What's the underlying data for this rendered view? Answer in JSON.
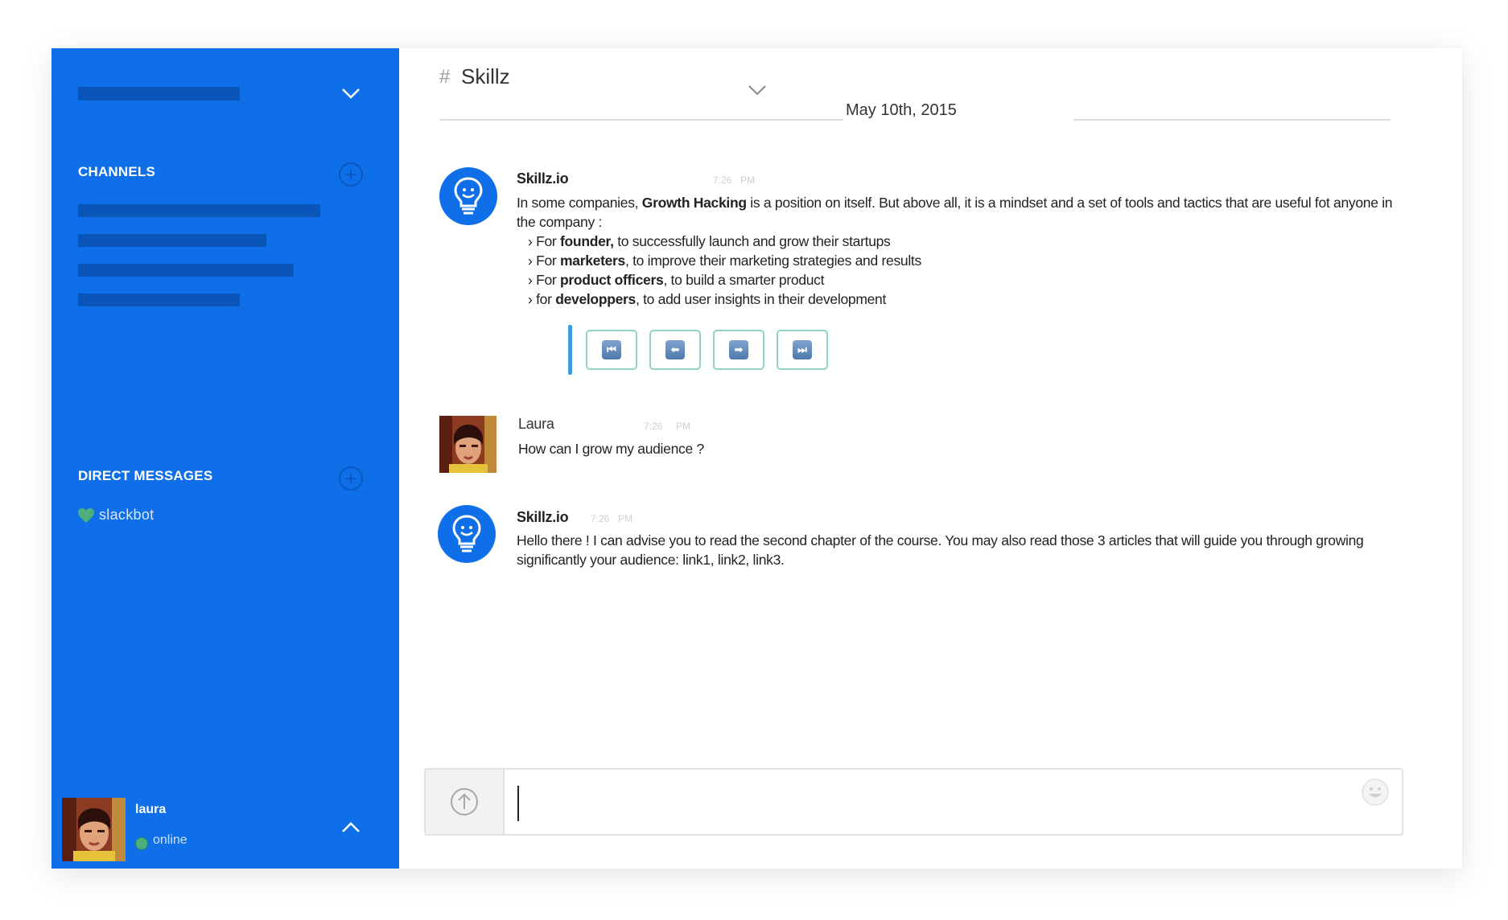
{
  "sidebar": {
    "channels_title": "CHANNELS",
    "dm_title": "DIRECT MESSAGES",
    "direct_messages": [
      {
        "name": "slackbot"
      }
    ],
    "current_user": {
      "name": "laura",
      "status": "online"
    }
  },
  "channel": {
    "hash": "#",
    "name": "Skillz",
    "date": "May 10th, 2015"
  },
  "messages": [
    {
      "author": "Skillz.io",
      "time": "7:26",
      "ampm": "PM",
      "intro_a": "In some companies, ",
      "intro_bold": "Growth Hacking",
      "intro_b": " is a position on itself. But above all, it is a mindset and a set of tools and tactics that are useful fot anyone in the company :",
      "bullets": [
        {
          "pre": "› For ",
          "bold": "founder,",
          "post": " to successfully launch and grow their startups"
        },
        {
          "pre": "› For ",
          "bold": "marketers",
          "post": ", to improve their marketing strategies and results"
        },
        {
          "pre": "› For ",
          "bold": "product officers",
          "post": ", to build a smarter product"
        },
        {
          "pre": "› for ",
          "bold": "developpers",
          "post": ", to add user insights in their development"
        }
      ],
      "nav_buttons": [
        {
          "icon": "first-icon",
          "glyph": "⏮"
        },
        {
          "icon": "prev-icon",
          "glyph": "⬅"
        },
        {
          "icon": "next-icon",
          "glyph": "➡"
        },
        {
          "icon": "last-icon",
          "glyph": "⏭"
        }
      ]
    },
    {
      "author": "Laura",
      "time": "7:26",
      "ampm": "PM",
      "text": "How can I grow my audience ?"
    },
    {
      "author": "Skillz.io",
      "time": "7:26",
      "ampm": "PM",
      "text": "Hello there ! I can advise you to read the second chapter of the course. You may also read those 3 articles that will guide you through growing significantly your audience: link1, link2, link3."
    }
  ],
  "composer": {
    "value": ""
  },
  "colors": {
    "sidebar": "#0e6fe8",
    "sidebar_bars": "#0a55b8",
    "online": "#4caf7d",
    "nav_border": "#8fd3c8"
  }
}
